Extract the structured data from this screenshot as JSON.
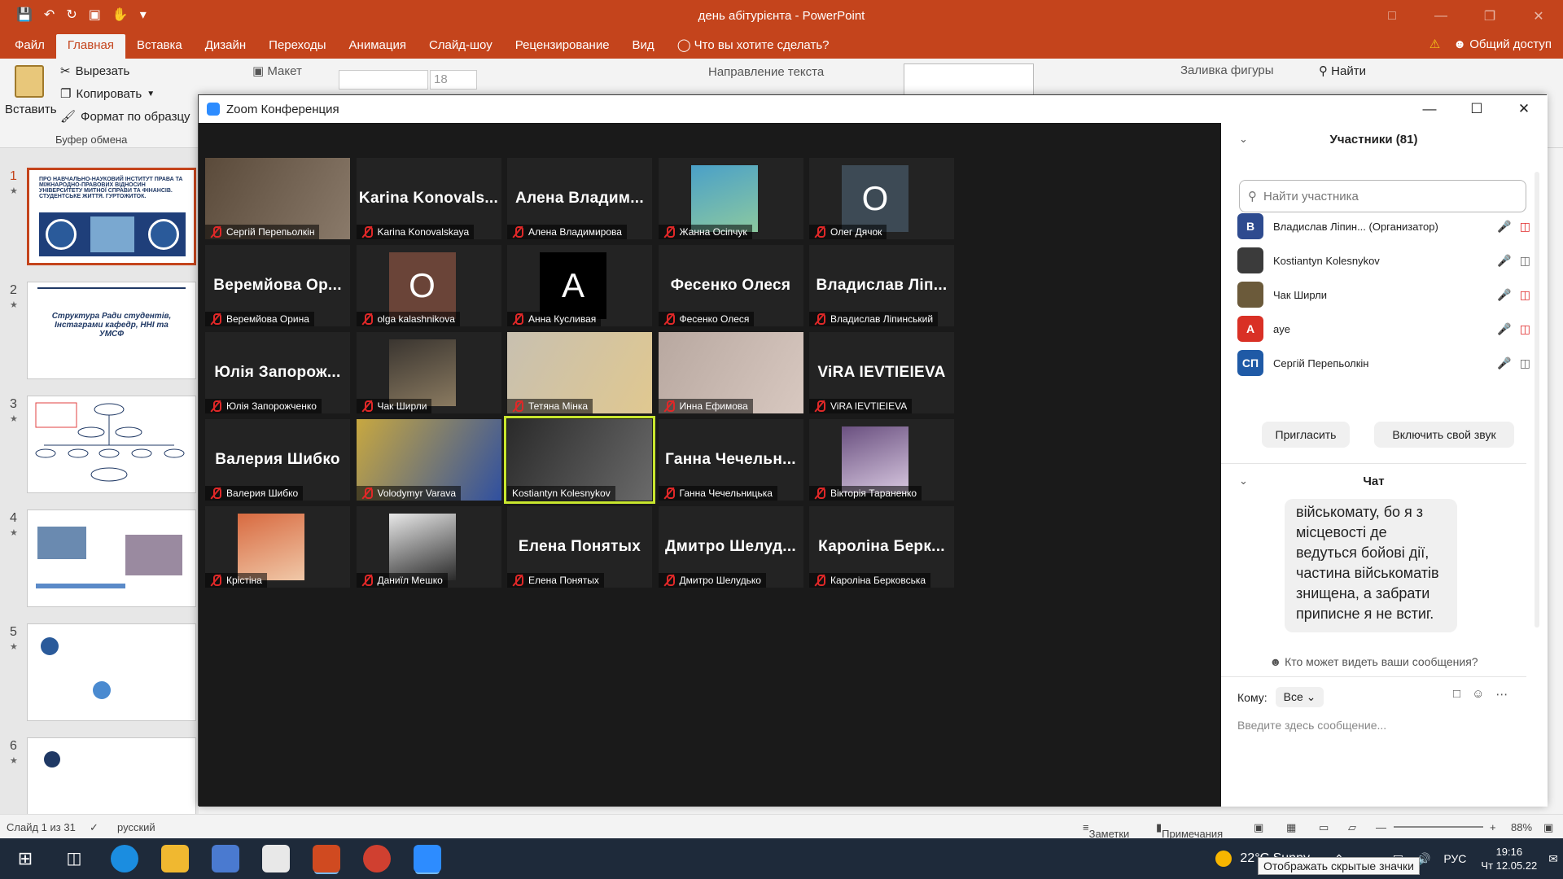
{
  "window_title": "день абітурієнта - PowerPoint",
  "menu": {
    "tabs": [
      "Файл",
      "Главная",
      "Вставка",
      "Дизайн",
      "Переходы",
      "Анимация",
      "Слайд-шоу",
      "Рецензирование",
      "Вид"
    ],
    "search_hint": "Что вы хотите сделать?",
    "share": "Общий доступ"
  },
  "ribbon": {
    "paste": "Вставить",
    "cut": "Вырезать",
    "copy": "Копировать",
    "format_painter": "Формат по образцу",
    "clipboard_group": "Буфер обмена",
    "layout": "Макет",
    "font_size": "18",
    "text_direction": "Направление текста",
    "shape_fill": "Заливка фигуры",
    "find": "Найти"
  },
  "slides": [
    {
      "num": "1",
      "thumb_text": "ПРО НАВЧАЛЬНО-НАУКОВИЙ ІНСТИТУТ ПРАВА ТА МІЖНАРОДНО-ПРАВОВИХ ВІДНОСИН УНІВЕРСИТЕТУ МИТНОЇ СПРАВИ ТА ФІНАНСІВ. СТУДЕНТСЬКЕ ЖИТТЯ. ГУРТОЖИТОК."
    },
    {
      "num": "2",
      "thumb_text": "Структура Ради студентів, Інстаграми кафедр, ННІ та УМСФ"
    },
    {
      "num": "3",
      "thumb_text": ""
    },
    {
      "num": "4",
      "thumb_text": ""
    },
    {
      "num": "5",
      "thumb_text": ""
    },
    {
      "num": "6",
      "thumb_text": ""
    }
  ],
  "statusbar": {
    "slide_info": "Слайд 1 из 31",
    "language": "русский",
    "notes": "Заметки",
    "comments": "Примечания",
    "zoom": "88%"
  },
  "zoom": {
    "title": "Zoom Конференция",
    "participants_header": "Участники (81)",
    "search_placeholder": "Найти участника",
    "participants": [
      {
        "initials": "В",
        "name": "Владислав Ліпин... (Организатор)",
        "color": "#2e4b8f",
        "mic": "off",
        "cam": "off"
      },
      {
        "initials": "",
        "name": "Kostiantyn Kolesnykov",
        "color": "#3b3b3b",
        "mic": "on",
        "cam": "on"
      },
      {
        "initials": "",
        "name": "Чак Ширли",
        "color": "#6b5a3a",
        "mic": "on",
        "cam": "off"
      },
      {
        "initials": "A",
        "name": "aye",
        "color": "#d93025",
        "mic": "off",
        "cam": "off"
      },
      {
        "initials": "СП",
        "name": "Сергій Перепьолкін",
        "color": "#1f5aa6",
        "mic": "off",
        "cam": "on"
      }
    ],
    "invite_button": "Пригласить",
    "unmute_button": "Включить свой звук",
    "chat_header": "Чат",
    "chat_message": "військомату, бо я з місцевості де ведуться бойові дії, частина військоматів знищена, а забрати приписне я не встиг.",
    "who_sees": "Кто может видеть ваши сообщения?",
    "to_label": "Кому:",
    "to_value": "Все",
    "input_placeholder": "Введите здесь сообщение...",
    "tiles": [
      {
        "name": "Сергій Перепьолкін",
        "type": "video",
        "colors": [
          "#5a4a3a",
          "#8a7a6a"
        ]
      },
      {
        "name": "Karina Konovalskaya",
        "type": "text",
        "big": "Karina Konovals..."
      },
      {
        "name": "Алена Владимирова",
        "type": "text",
        "big": "Алена Владим..."
      },
      {
        "name": "Жанна Осіпчук",
        "type": "photo",
        "colors": [
          "#4aa0c8",
          "#8cc9a0"
        ]
      },
      {
        "name": "Олег Дячок",
        "type": "avatar",
        "letter": "O",
        "bg": "#3d4a55"
      },
      {
        "name": "Веремйова Орина",
        "type": "text",
        "big": "Веремйова Ор..."
      },
      {
        "name": "olga kalashnikova",
        "type": "avatar",
        "letter": "O",
        "bg": "#6a4438"
      },
      {
        "name": "Анна Кусливая",
        "type": "avatar",
        "letter": "A",
        "bg": "#000000"
      },
      {
        "name": "Фесенко Олеся",
        "type": "text",
        "big": "Фесенко Олеся"
      },
      {
        "name": "Владислав Ліпинський",
        "type": "text",
        "big": "Владислав Ліп..."
      },
      {
        "name": "Юлія Запорожченко",
        "type": "text",
        "big": "Юлія Запорож..."
      },
      {
        "name": "Чак Ширли",
        "type": "photo",
        "colors": [
          "#3a3530",
          "#8a7a60"
        ]
      },
      {
        "name": "Тетяна Мінка",
        "type": "video",
        "colors": [
          "#c8c0b0",
          "#e0c890"
        ]
      },
      {
        "name": "Инна Ефимова",
        "type": "video",
        "colors": [
          "#b8a8a0",
          "#d8c8c0"
        ]
      },
      {
        "name": "ViRA IEVTIEIEVA",
        "type": "text",
        "big": "ViRA IEVTIEIEVA"
      },
      {
        "name": "Валерия Шибко",
        "type": "text",
        "big": "Валерия Шибко"
      },
      {
        "name": "Volodymyr Varava",
        "type": "video",
        "colors": [
          "#c8a840",
          "#3050a0"
        ]
      },
      {
        "name": "Kostiantyn Kolesnykov",
        "type": "video",
        "colors": [
          "#2a2a2a",
          "#6a6a6a"
        ],
        "speaking": true
      },
      {
        "name": "Ганна Чечельницька",
        "type": "text",
        "big": "Ганна Чечельн..."
      },
      {
        "name": "Вікторія Тараненко",
        "type": "photo",
        "colors": [
          "#6a5080",
          "#d8c8e0"
        ]
      },
      {
        "name": "Крістіна",
        "type": "photo",
        "colors": [
          "#d86a40",
          "#f0c8a8"
        ]
      },
      {
        "name": "Даниїл Мешко",
        "type": "photo",
        "colors": [
          "#e8e8e8",
          "#2a2a2a"
        ]
      },
      {
        "name": "Елена Понятых",
        "type": "text",
        "big": "Елена Понятых"
      },
      {
        "name": "Дмитро Шелудько",
        "type": "text",
        "big": "Дмитро Шелуд..."
      },
      {
        "name": "Кароліна Берковська",
        "type": "text",
        "big": "Кароліна Берк..."
      }
    ]
  },
  "taskbar": {
    "weather": "22°C  Sunny",
    "lang": "РУС",
    "time": "19:16",
    "date": "Чт 12.05.22",
    "tooltip": "Отображать скрытые значки"
  },
  "colors": {
    "accent": "#c4441c",
    "zoom_blue": "#2d8cff",
    "speaking": "#c8e62e"
  }
}
